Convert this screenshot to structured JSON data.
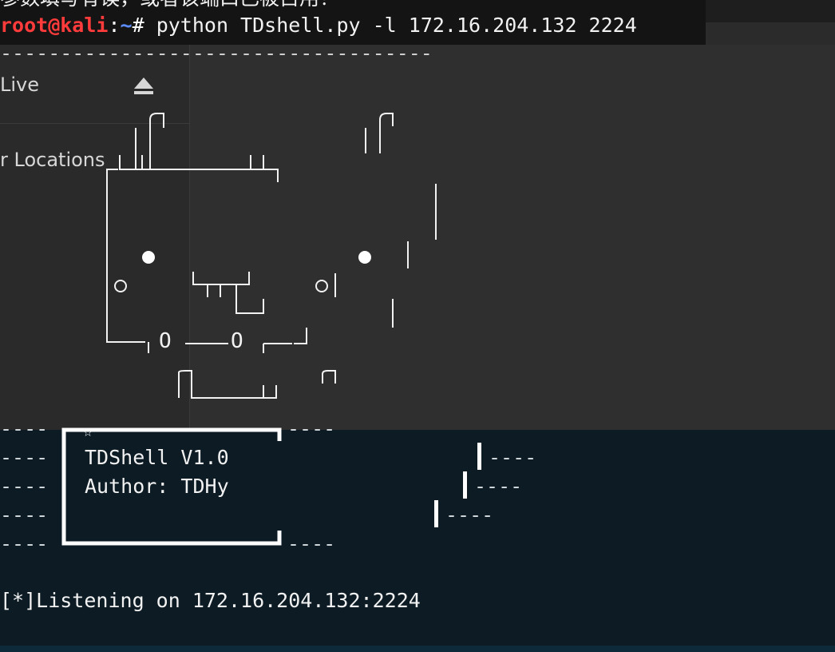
{
  "topline_cjk": "参数填写有误，或者该端口已被占用！",
  "prompt": {
    "user_host": "root@kali",
    "colon": ":",
    "path": "~",
    "hash": "# ",
    "command": "python TDshell.py -l 172.16.204.132 2224"
  },
  "separator": "------------------------------------",
  "file_manager": {
    "live_label": "Live",
    "other_locations_label": "r Locations"
  },
  "banner": {
    "title": "TDShell V1.0",
    "author": "Author: TDHy",
    "star": "☆",
    "dash": "----",
    "mouth_o": "O"
  },
  "listening": "[*]Listening on 172.16.204.132:2224",
  "colors": {
    "prompt_red": "#ff3b3b",
    "prompt_blue": "#5c8cff",
    "terminal_bg": "#0c1b24",
    "panel_bg": "#2f2f2f"
  }
}
